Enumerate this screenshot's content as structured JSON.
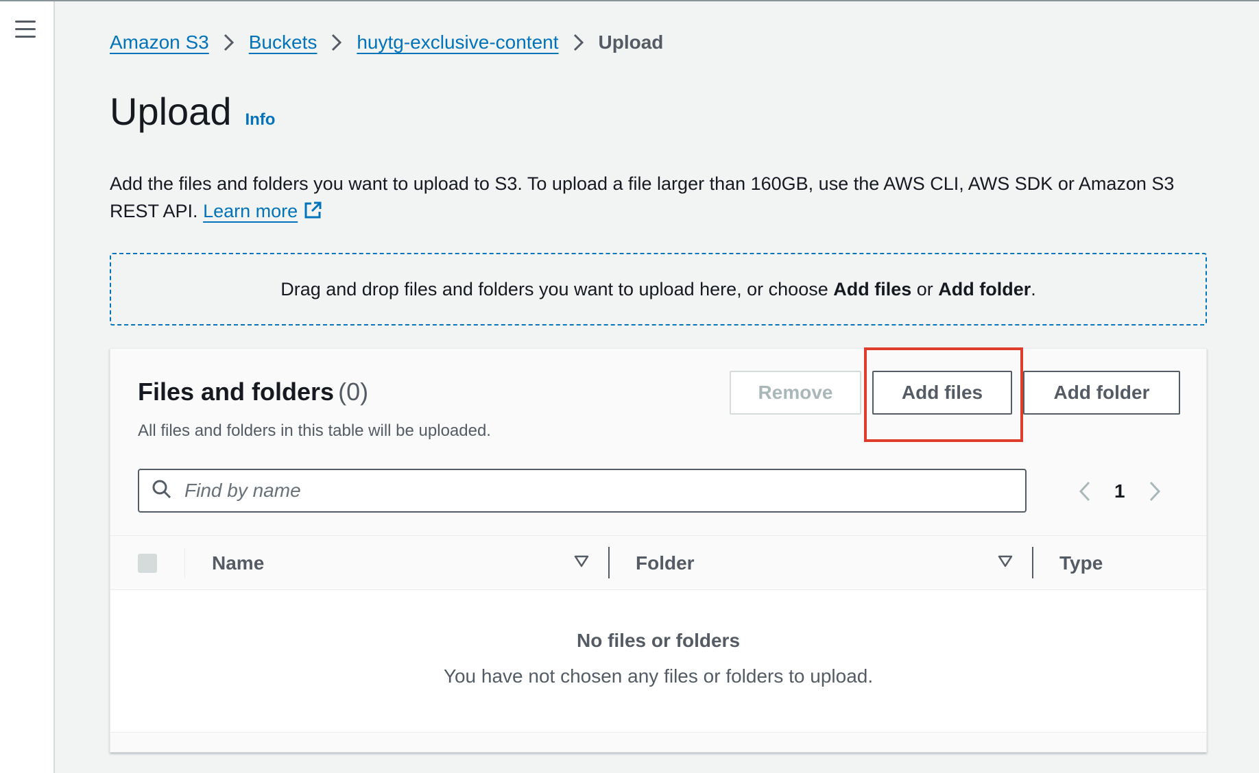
{
  "breadcrumb": {
    "items": [
      "Amazon S3",
      "Buckets",
      "huytg-exclusive-content"
    ],
    "current": "Upload"
  },
  "page": {
    "title": "Upload",
    "info": "Info",
    "description": "Add the files and folders you want to upload to S3. To upload a file larger than 160GB, use the AWS CLI, AWS SDK or Amazon S3 REST API.",
    "learn_more": "Learn more"
  },
  "dropzone": {
    "text_before": "Drag and drop files and folders you want to upload here, or choose ",
    "add_files": "Add files",
    "text_or": " or ",
    "add_folder": "Add folder",
    "text_end": "."
  },
  "panel": {
    "title": "Files and folders",
    "count": "(0)",
    "subtitle": "All files and folders in this table will be uploaded.",
    "remove_label": "Remove",
    "add_files_label": "Add files",
    "add_folder_label": "Add folder"
  },
  "search": {
    "placeholder": "Find by name",
    "value": ""
  },
  "pagination": {
    "current_page": "1"
  },
  "table": {
    "columns": [
      "Name",
      "Folder",
      "Type"
    ],
    "empty_title": "No files or folders",
    "empty_subtitle": "You have not chosen any files or folders to upload."
  },
  "icons": {
    "menu": "hamburger-menu-icon",
    "breadcrumb_separator": "chevron-right-icon",
    "external_link": "external-link-icon",
    "search": "search-icon",
    "prev": "chevron-left-icon",
    "next": "chevron-right-icon",
    "sort": "caret-down-icon"
  },
  "colors": {
    "link": "#0073bb",
    "highlight": "#e03c2c",
    "text": "#16191f",
    "muted": "#545b64",
    "background": "#f2f3f3"
  }
}
